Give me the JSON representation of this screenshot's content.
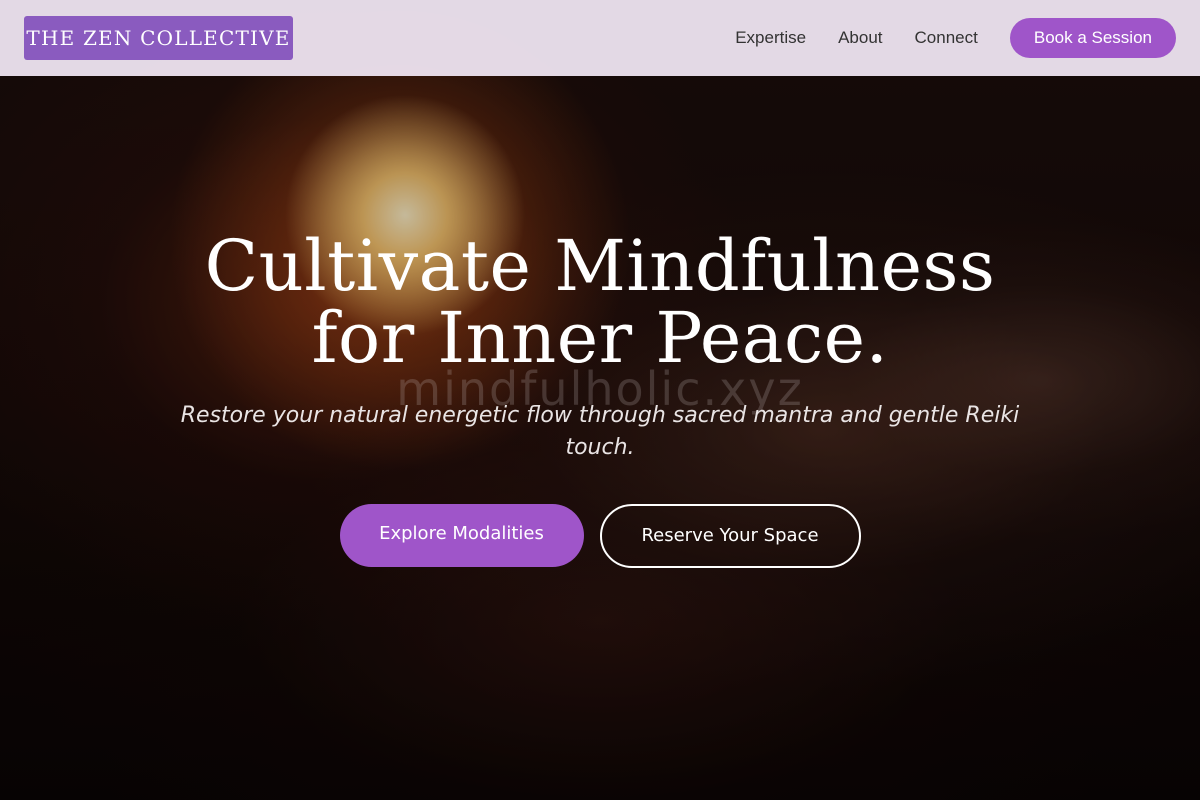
{
  "header": {
    "logo_text": "THE ZEN COLLECTIVE",
    "nav": [
      {
        "label": "Expertise"
      },
      {
        "label": "About"
      },
      {
        "label": "Connect"
      }
    ],
    "cta_label": "Book a Session"
  },
  "hero": {
    "title": "Cultivate Mindfulness for Inner Peace.",
    "watermark": "mindfulholic.xyz",
    "subtitle": "Restore your natural energetic flow through sacred mantra and gentle Reiki touch.",
    "primary_button": "Explore Modalities",
    "secondary_button": "Reserve Your Space"
  },
  "colors": {
    "accent": "#9f55c9",
    "logo_bg": "#8a5bbf",
    "header_bg": "#ece2ee"
  }
}
